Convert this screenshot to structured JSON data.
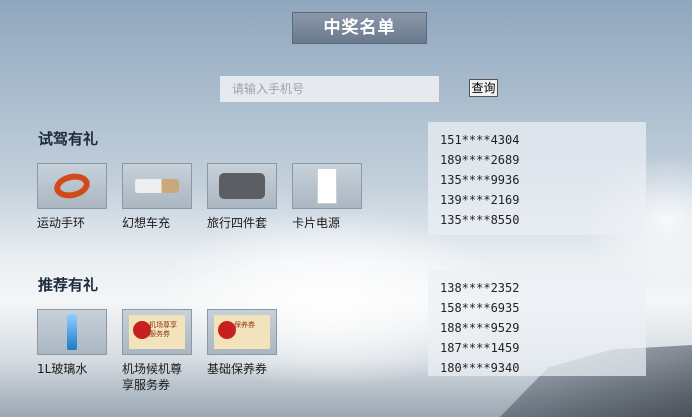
{
  "header": {
    "title": "中奖名单"
  },
  "search": {
    "placeholder": "请输入手机号",
    "button_label": "查询"
  },
  "sections": [
    {
      "title": "试驾有礼",
      "prizes": [
        {
          "label": "运动手环",
          "icon": "wristband-icon"
        },
        {
          "label": "幻想车充",
          "icon": "car-charger-icon"
        },
        {
          "label": "旅行四件套",
          "icon": "travel-bag-icon"
        },
        {
          "label": "卡片电源",
          "icon": "power-card-icon"
        }
      ],
      "winners": [
        "151****4304",
        "189****2689",
        "135****9936",
        "139****2169",
        "135****8550"
      ]
    },
    {
      "title": "推荐有礼",
      "prizes": [
        {
          "label": "1L玻璃水",
          "icon": "washer-fluid-bottle-icon"
        },
        {
          "label_lines": [
            "机场候机尊",
            "享服务券"
          ],
          "icon": "airport-voucher-icon",
          "icon_text": "机场尊享服务券"
        },
        {
          "label": "基础保养券",
          "icon": "maintenance-voucher-icon",
          "icon_text": "保养券"
        }
      ],
      "winners": [
        "138****2352",
        "158****6935",
        "188****9529",
        "187****1459",
        "180****9340"
      ]
    }
  ],
  "colors": {
    "title_bg": "#7b889a",
    "section_title": "#1c2a3c",
    "band": "#d24a1c"
  }
}
